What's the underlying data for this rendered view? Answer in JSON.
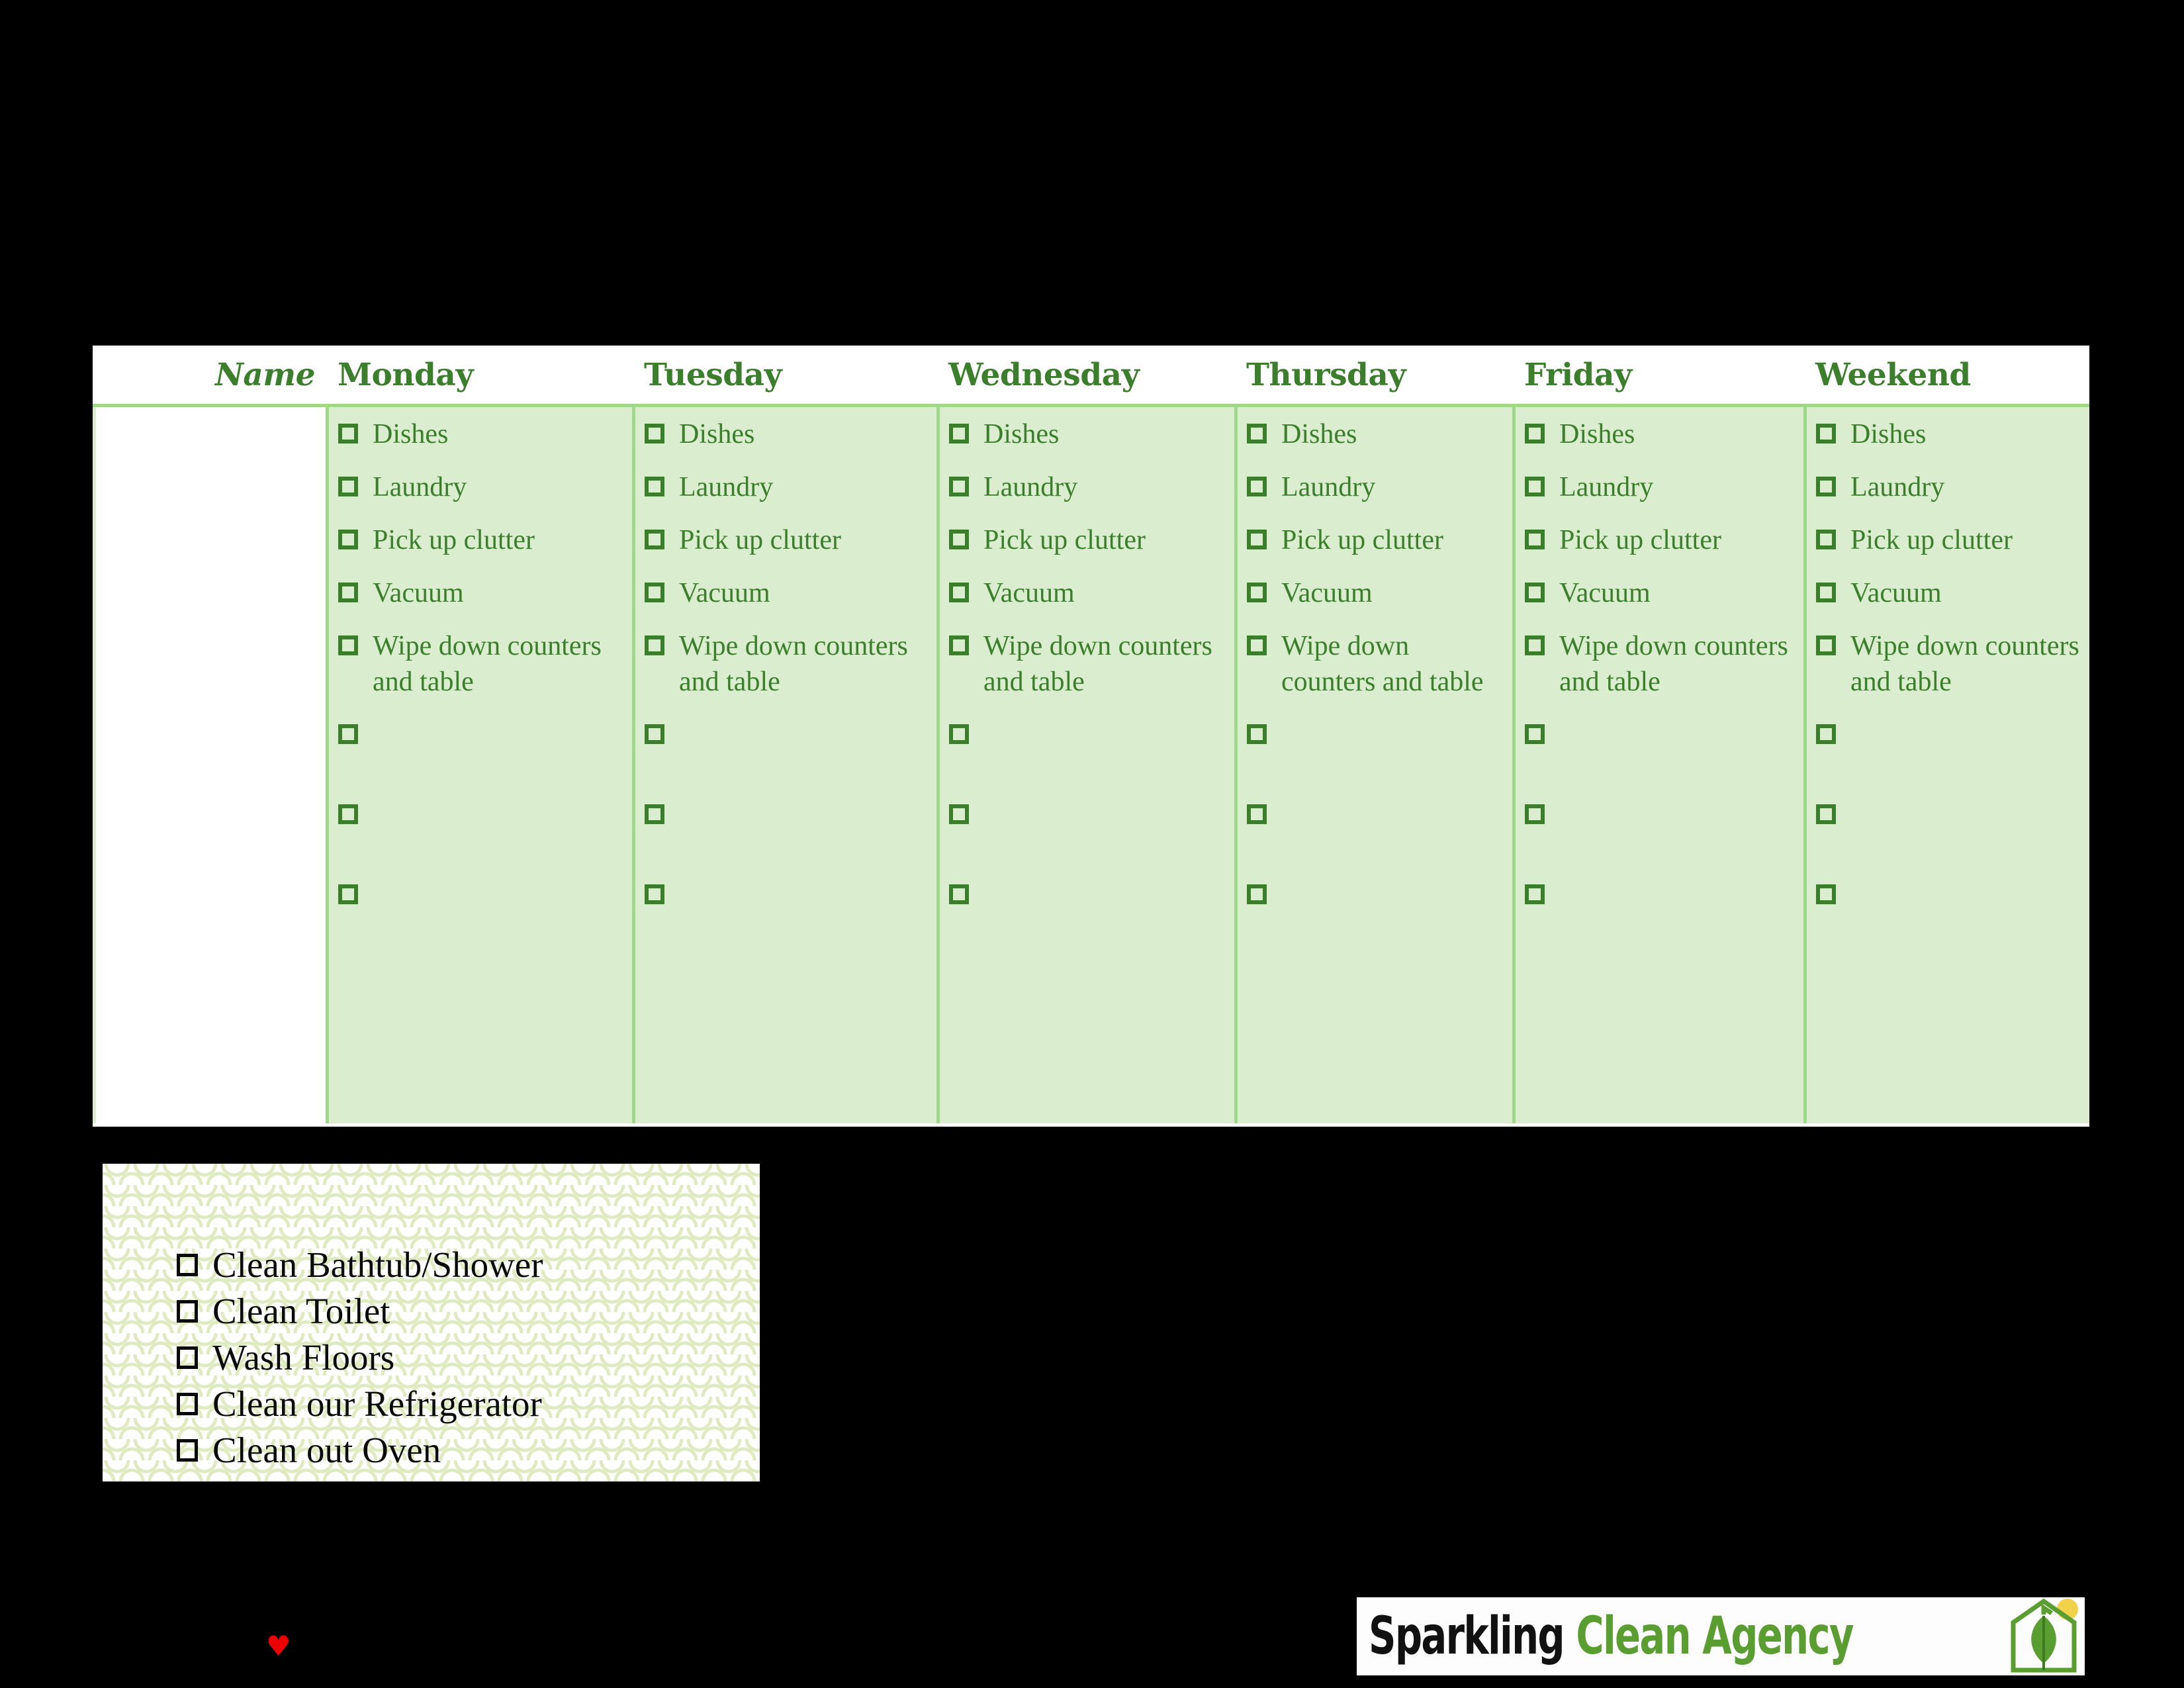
{
  "table": {
    "columns": [
      "Name",
      "Monday",
      "Tuesday",
      "Wednesday",
      "Thursday",
      "Friday",
      "Weekend"
    ],
    "accent_green": "#3b7e2b",
    "cell_background": "#daedcf",
    "border_green": "#9ed888",
    "tasks": {
      "dishes": "Dishes",
      "laundry": "Laundry",
      "clutter": "Pick up clutter",
      "vacuum": "Vacuum",
      "wipe": "Wipe down counters and table"
    },
    "days": [
      {
        "day": "Monday",
        "tasks": [
          "Dishes",
          "Laundry",
          "Pick up clutter",
          "Vacuum",
          "Wipe down counters and table"
        ],
        "blank_rows": 3
      },
      {
        "day": "Tuesday",
        "tasks": [
          "Dishes",
          "Laundry",
          "Pick up clutter",
          "Vacuum",
          "Wipe down counters and table"
        ],
        "blank_rows": 3
      },
      {
        "day": "Wednesday",
        "tasks": [
          "Dishes",
          "Laundry",
          "Pick up clutter",
          "Vacuum",
          "Wipe down counters and table"
        ],
        "blank_rows": 3
      },
      {
        "day": "Thursday",
        "tasks": [
          "Dishes",
          "Laundry",
          "Pick up clutter",
          "Vacuum",
          "Wipe down counters and table"
        ],
        "blank_rows": 3
      },
      {
        "day": "Friday",
        "tasks": [
          "Dishes",
          "Laundry",
          "Pick up clutter",
          "Vacuum",
          "Wipe down counters and table"
        ],
        "blank_rows": 3
      },
      {
        "day": "Weekend",
        "tasks": [
          "Dishes",
          "Laundry",
          "Pick up clutter",
          "Vacuum",
          "Wipe down counters and table"
        ],
        "blank_rows": 3
      }
    ]
  },
  "extra_chores": {
    "items": [
      "Clean Bathtub/Shower",
      "Clean Toilet",
      "Wash Floors",
      "Clean our Refrigerator",
      "Clean out Oven"
    ],
    "pattern_color": "#dfeac0"
  },
  "decoration": {
    "heart": "♥",
    "heart_color": "#ee0000"
  },
  "logo": {
    "word1": "Sparkling",
    "word2": "Clean Agency",
    "word1_color": "#111111",
    "word2_color": "#5a9e31",
    "mark_leaf_color": "#5a9e31",
    "mark_sun_color": "#f2d24b"
  }
}
